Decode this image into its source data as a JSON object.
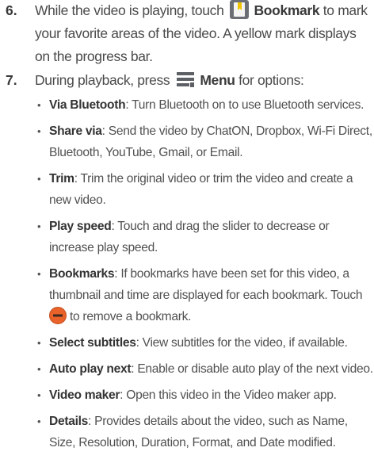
{
  "steps": [
    {
      "number": "6.",
      "text_before_icon": "While the video is playing, touch",
      "icon": "bookmark-icon",
      "label": "Bookmark",
      "text_after": "to mark your favorite areas of the video. A yellow mark displays on the progress bar."
    },
    {
      "number": "7.",
      "text_before_icon": "During playback, press",
      "icon": "menu-icon",
      "label": "Menu",
      "text_after": "for options:"
    }
  ],
  "options": [
    {
      "term": "Via Bluetooth",
      "desc": ": Turn Bluetooth on to use Bluetooth services."
    },
    {
      "term": "Share via",
      "desc": ": Send the video by ChatON, Dropbox, Wi-Fi Direct, Bluetooth, YouTube, Gmail, or Email."
    },
    {
      "term": "Trim",
      "desc": ": Trim the original video or trim the video and create a new video."
    },
    {
      "term": "Play speed",
      "desc": ": Touch and drag the slider to decrease or increase play speed."
    },
    {
      "term": "Bookmarks",
      "desc": ": If bookmarks have been set for this video, a thumbnail and time are displayed for each bookmark. Touch",
      "icon": "remove-icon",
      "desc_after": "to remove a bookmark."
    },
    {
      "term": "Select subtitles",
      "desc": ": View subtitles for the video, if available."
    },
    {
      "term": "Auto play next",
      "desc": ": Enable or disable auto play of the next video."
    },
    {
      "term": "Video maker",
      "desc": ": Open this video in the Video maker app."
    },
    {
      "term": "Details",
      "desc": ": Provides details about the video, such as Name, Size, Resolution, Duration, Format, and Date modified."
    }
  ],
  "bullet_char": "•",
  "colors": {
    "bookmark_icon_bg": "#6b6f75",
    "bookmark_ribbon": "#f2c400",
    "menu_icon": "#5c5f63",
    "remove_icon": "#e8622a"
  }
}
